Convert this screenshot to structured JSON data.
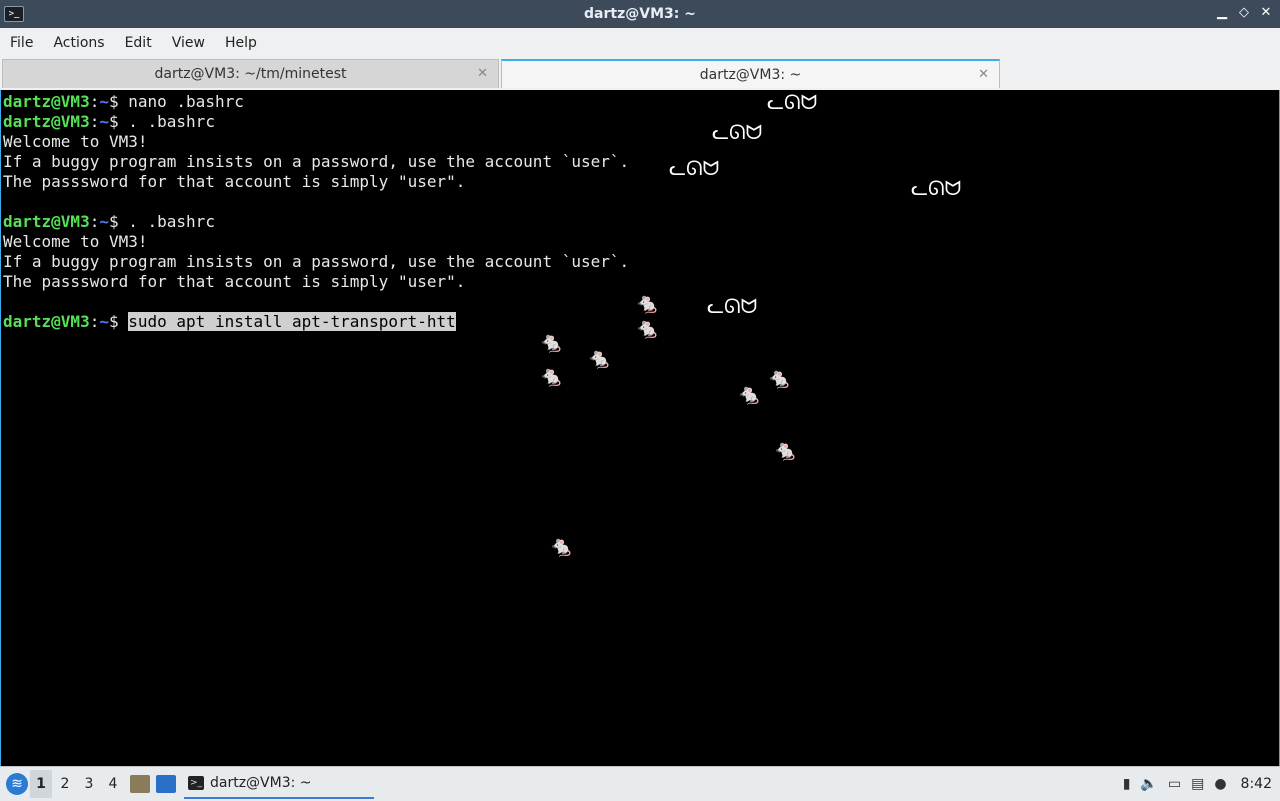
{
  "window": {
    "title": "dartz@VM3: ~",
    "minimize": "▁",
    "maximize": "◇",
    "close": "✕"
  },
  "menu": [
    "File",
    "Actions",
    "Edit",
    "View",
    "Help"
  ],
  "tabs": [
    {
      "label": "dartz@VM3: ~/tm/minetest",
      "close": "✕",
      "active": false
    },
    {
      "label": "dartz@VM3: ~",
      "close": "✕",
      "active": true
    }
  ],
  "terminal": {
    "prompt_user": "dartz@VM3",
    "prompt_sep": ":",
    "prompt_path": "~",
    "prompt_sign": "$ ",
    "lines": [
      {
        "type": "prompt",
        "cmd": "nano .bashrc"
      },
      {
        "type": "prompt",
        "cmd": ". .bashrc"
      },
      {
        "type": "output",
        "text": "Welcome to VM3!"
      },
      {
        "type": "output",
        "text": "If a buggy program insists on a password, use the account `user`."
      },
      {
        "type": "output",
        "text": "The passsword for that account is simply \"user\"."
      },
      {
        "type": "output",
        "text": ""
      },
      {
        "type": "prompt",
        "cmd": ". .bashrc"
      },
      {
        "type": "output",
        "text": "Welcome to VM3!"
      },
      {
        "type": "output",
        "text": "If a buggy program insists on a password, use the account `user`."
      },
      {
        "type": "output",
        "text": "The passsword for that account is simply \"user\"."
      },
      {
        "type": "output",
        "text": ""
      },
      {
        "type": "prompt",
        "cmd": "sudo apt install apt-transport-htt",
        "selected": true
      }
    ]
  },
  "sprites": {
    "cat_glyph": "ᓚᘏᗢ",
    "mouse_glyph": "🐁"
  },
  "taskbar": {
    "start_icon": "menu-icon",
    "workspaces": [
      "1",
      "2",
      "3",
      "4"
    ],
    "active_workspace": "1",
    "task_label": "dartz@VM3: ~",
    "tray_icons": [
      "battery-icon",
      "volume-icon",
      "network-icon",
      "clipboard-icon",
      "notification-icon"
    ],
    "clock": "8:42"
  }
}
